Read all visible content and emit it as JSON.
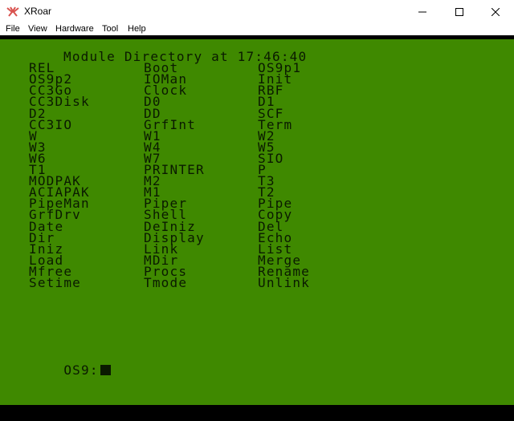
{
  "window": {
    "title": "XRoar",
    "icon": "xroar-icon"
  },
  "menu": [
    "File",
    "View",
    "Hardware",
    "Tool",
    "Help"
  ],
  "terminal": {
    "header": "Module Directory at 17:46:40",
    "columns": [
      [
        "REL",
        "OS9p2",
        "CC3Go",
        "CC3Disk",
        "D2",
        "CC3IO",
        "W",
        "W3",
        "W6",
        "T1",
        "MODPAK",
        "ACIAPAK",
        "PipeMan",
        "GrfDrv",
        "Date",
        "Dir",
        "Iniz",
        "Load",
        "Mfree",
        "Setime"
      ],
      [
        "Boot",
        "IOMan",
        "Clock",
        "D0",
        "DD",
        "GrfInt",
        "W1",
        "W4",
        "W7",
        "PRINTER",
        "M2",
        "M1",
        "Piper",
        "Shell",
        "DeIniz",
        "Display",
        "Link",
        "MDir",
        "Procs",
        "Tmode"
      ],
      [
        "OS9p1",
        "Init",
        "RBF",
        "D1",
        "SCF",
        "Term",
        "W2",
        "W5",
        "SIO",
        "P",
        "T3",
        "T2",
        "Pipe",
        "Copy",
        "Del",
        "Echo",
        "List",
        "Merge",
        "Rename",
        "Unlink"
      ]
    ],
    "prompt": "OS9:"
  },
  "colors": {
    "screen_bg": "#3f8900",
    "text": "#0a1a00"
  }
}
